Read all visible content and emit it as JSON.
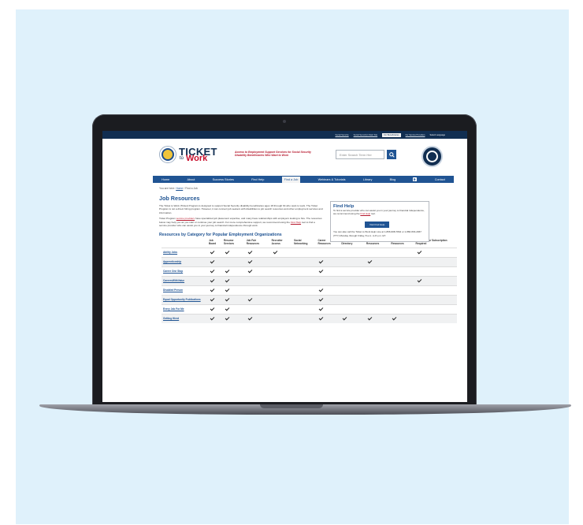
{
  "utility_nav": [
    "Social Security",
    "Social Security's Main Site",
    "For Beneficiaries",
    "For Service Providers",
    "Select Language"
  ],
  "utility_active_index": 2,
  "brand": {
    "ticket": "TICKET",
    "to": "to",
    "work": "Work"
  },
  "tagline": "Access to Employment Support Services for Social Security Disability Beneficiaries Who Want to Work",
  "search": {
    "placeholder": "Enter Search Term Her"
  },
  "nav": [
    "Home",
    "About",
    "Success Stories",
    "Find Help",
    "Find a Job",
    "Webinars & Tutorials",
    "Library",
    "Blog",
    "Contact"
  ],
  "nav_current_index": 4,
  "breadcrumb": {
    "prefix": "You are here:",
    "home": "Home",
    "sep": "/",
    "current": "Find a Job"
  },
  "page_title": "Job Resources",
  "intro_paragraph_1": "The Ticket to Work (Ticket) Program is designed to support Social Security disability beneficiaries ages 18 through 64 who want to work. The Ticket Program is not a direct hiring program. However, it can connect job seekers with disabilities to job search resources and other employment services and information.",
  "intro_p2": {
    "pre": "Ticket Program ",
    "link1": "service providers",
    "mid": " have specialized job placement expertise, and many have relationships with employers looking to hire. The resources below may help you as you start or continue your job search. For more comprehensive support, we recommend using the ",
    "link2": "Find Help",
    "post": " tool to find a service provider who can assist you in your journey to financial independence through work."
  },
  "find_help": {
    "title": "Find Help",
    "text1_pre": "To find a service provider who can assist you in your journey to financial independence, we recommend using the ",
    "text1_link": "Find Help",
    "text1_post": " tool.",
    "button": "Visit Find Help",
    "text2": "You can also call the Ticket to Work Help Line at 1-866-968-7842 or 1-866-833-2967 (TTY) Monday through Friday, 8 a.m. to 8 p.m. ET."
  },
  "table_title": "Resources by Category for Popular Employment Organizations",
  "table": {
    "headers": [
      "",
      "Job Board",
      "Resume Services",
      "Job Fair Resources",
      "Recruiter Access",
      "Social Networking",
      "Career Resources",
      "Employer Directory",
      "Student Resources",
      "Veteran Resources",
      "Membership/ Subscription Required"
    ],
    "rows": [
      {
        "name": "Ability Jobs",
        "checks": [
          1,
          1,
          1,
          1,
          0,
          0,
          0,
          0,
          0,
          1
        ]
      },
      {
        "name": "Apprenticeship",
        "checks": [
          1,
          0,
          1,
          0,
          0,
          1,
          0,
          1,
          0,
          0
        ]
      },
      {
        "name": "Career One Stop",
        "checks": [
          1,
          1,
          1,
          0,
          0,
          1,
          0,
          0,
          0,
          0
        ]
      },
      {
        "name": "CareersWithValue",
        "checks": [
          1,
          1,
          0,
          0,
          0,
          0,
          0,
          0,
          0,
          1
        ]
      },
      {
        "name": "Disabled Person",
        "checks": [
          1,
          1,
          0,
          0,
          0,
          1,
          0,
          0,
          0,
          0
        ]
      },
      {
        "name": "Equal Opportunity Publications",
        "checks": [
          1,
          1,
          1,
          0,
          0,
          1,
          0,
          0,
          0,
          0
        ]
      },
      {
        "name": "Every Job For Me",
        "checks": [
          1,
          1,
          0,
          0,
          0,
          1,
          0,
          0,
          0,
          0
        ]
      },
      {
        "name": "Getting Hired",
        "checks": [
          1,
          1,
          1,
          0,
          0,
          1,
          1,
          1,
          1,
          0
        ]
      }
    ]
  },
  "colors": {
    "navy": "#112e51",
    "blue": "#205493",
    "red": "#b6172c",
    "backdrop": "#dff1fb"
  }
}
